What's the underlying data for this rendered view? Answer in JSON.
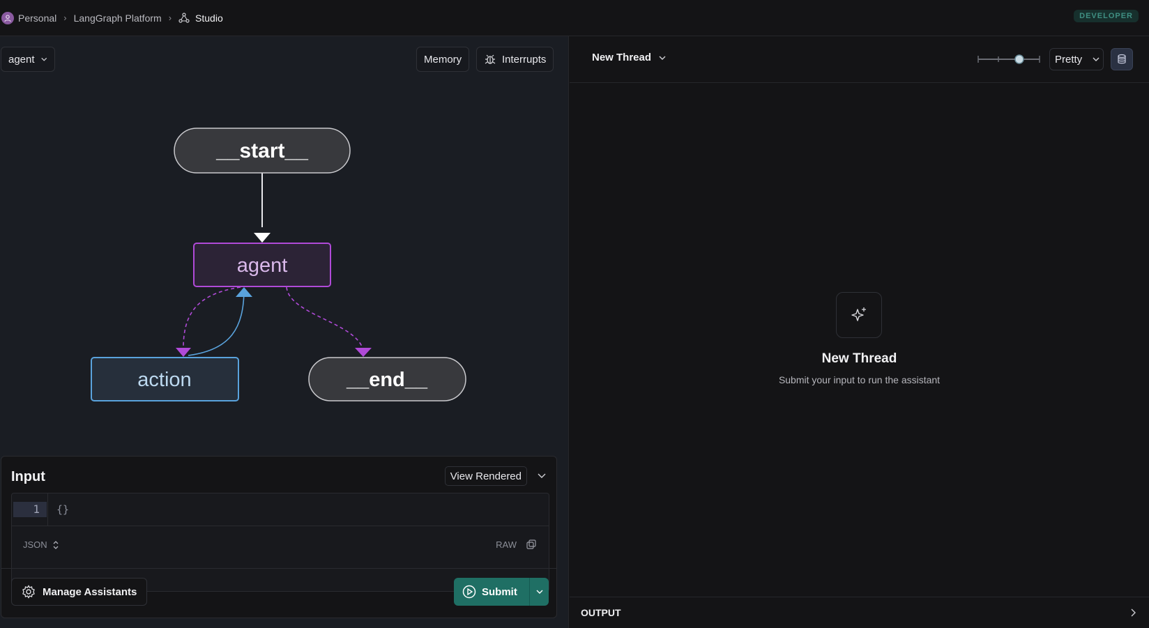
{
  "breadcrumb": {
    "items": [
      "Personal",
      "LangGraph Platform",
      "Studio"
    ]
  },
  "badge": "DEVELOPER",
  "graph_panel": {
    "assistant_select": "agent",
    "memory_button": "Memory",
    "interrupts_button": "Interrupts",
    "nodes": {
      "start": "__start__",
      "agent": "agent",
      "action": "action",
      "end": "__end__"
    }
  },
  "input_panel": {
    "title": "Input",
    "view_mode": "View Rendered",
    "line_number": "1",
    "code": "{}",
    "format": "JSON",
    "raw_label": "RAW",
    "manage_button": "Manage Assistants",
    "submit_button": "Submit"
  },
  "thread_panel": {
    "thread_select": "New Thread",
    "view_select": "Pretty",
    "slider_level": 0.67,
    "empty_title": "New Thread",
    "empty_subtitle": "Submit your input to run the assistant",
    "output_label": "OUTPUT"
  },
  "colors": {
    "accent": "#1f6f64",
    "agent_node": "#b04ad8",
    "action_node": "#5aa3dd"
  }
}
